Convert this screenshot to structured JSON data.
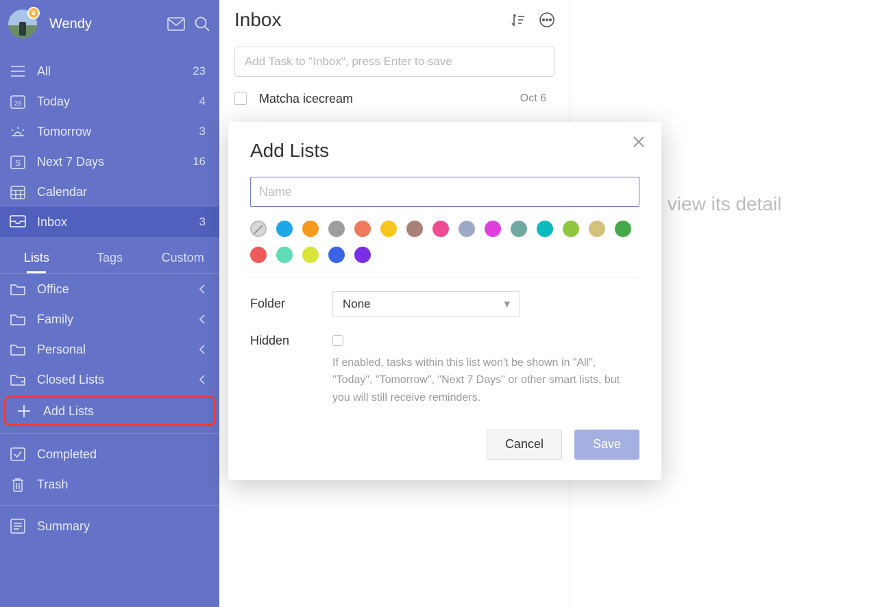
{
  "user": {
    "name": "Wendy"
  },
  "smart_lists": [
    {
      "id": "all",
      "label": "All",
      "count": 23
    },
    {
      "id": "today",
      "label": "Today",
      "count": 4
    },
    {
      "id": "tomorrow",
      "label": "Tomorrow",
      "count": 3
    },
    {
      "id": "next7",
      "label": "Next 7 Days",
      "count": 16
    },
    {
      "id": "calendar",
      "label": "Calendar",
      "count": null
    },
    {
      "id": "inbox",
      "label": "Inbox",
      "count": 3,
      "selected": true
    }
  ],
  "sidebar_tabs": {
    "lists": "Lists",
    "tags": "Tags",
    "custom": "Custom",
    "active": "lists"
  },
  "folders": [
    {
      "label": "Office"
    },
    {
      "label": "Family"
    },
    {
      "label": "Personal"
    },
    {
      "label": "Closed Lists"
    }
  ],
  "add_lists_label": "Add Lists",
  "system_lists": {
    "completed": "Completed",
    "trash": "Trash",
    "summary": "Summary"
  },
  "main": {
    "title": "Inbox",
    "add_placeholder": "Add Task to \"Inbox\", press Enter to save",
    "tasks": [
      {
        "title": "Matcha icecream",
        "date": "Oct 6"
      }
    ]
  },
  "detail_placeholder": "ask title to view its detail",
  "modal": {
    "title": "Add Lists",
    "name_placeholder": "Name",
    "name_value": "",
    "colors": [
      "none",
      "#1ea7e6",
      "#f59a1c",
      "#9e9e9e",
      "#f07a5b",
      "#f6c51f",
      "#a88076",
      "#ef4d93",
      "#9fa9c7",
      "#e03fe0",
      "#6fa9a1",
      "#0dbabd",
      "#8fc73e",
      "#d1c27d",
      "#46a84a",
      "#ef5a5a",
      "#5fdcb6",
      "#d8e43a",
      "#3a64e6",
      "#7a2ee6"
    ],
    "folder_label": "Folder",
    "folder_value": "None",
    "hidden_label": "Hidden",
    "hidden_checked": false,
    "hidden_hint": "If enabled, tasks within this list won't be shown in \"All\", \"Today\", \"Tomorrow\", \"Next 7 Days\" or other smart lists, but you will still receive reminders.",
    "cancel": "Cancel",
    "save": "Save"
  }
}
